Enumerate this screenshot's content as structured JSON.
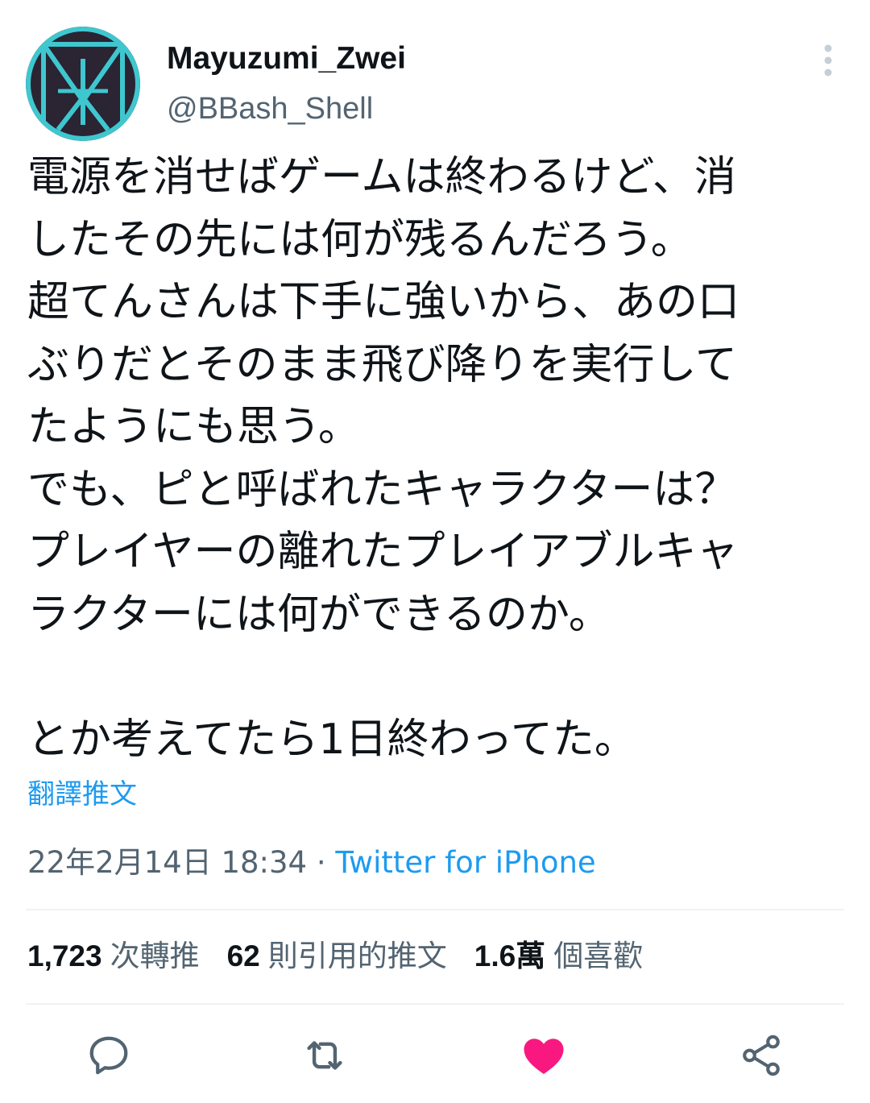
{
  "tweet": {
    "display_name": "Mayuzumi_Zwei",
    "handle": "@BBash_Shell",
    "lines": [
      "電源を消せばゲームは終わるけど、消",
      "したその先には何が残るんだろう。",
      "超てんさんは下手に強いから、あの口",
      "ぶりだとそのまま飛び降りを実行して",
      "たようにも思う。",
      "でも、ピと呼ばれたキャラクターは？",
      "プレイヤーの離れたプレイアブルキャ",
      "ラクターには何ができるのか。",
      "",
      "とか考えてたら1日終わってた。"
    ],
    "translate_label": "翻譯推文",
    "timestamp": "22年2月14日 18:34",
    "separator": "·",
    "source": "Twitter for iPhone"
  },
  "stats": {
    "retweets": {
      "count": "1,723",
      "label": "次轉推"
    },
    "quotes": {
      "count": "62",
      "label": "則引用的推文"
    },
    "likes": {
      "count": "1.6萬",
      "label": "個喜歡"
    }
  },
  "actions": {
    "reply": "reply-icon",
    "retweet": "retweet-icon",
    "like": "heart-icon",
    "share": "share-icon"
  },
  "colors": {
    "link": "#1d9bf0",
    "secondary_text": "#536471",
    "like_active": "#f91880",
    "avatar_bg": "#2a2433",
    "avatar_accent": "#3fc7cf"
  }
}
